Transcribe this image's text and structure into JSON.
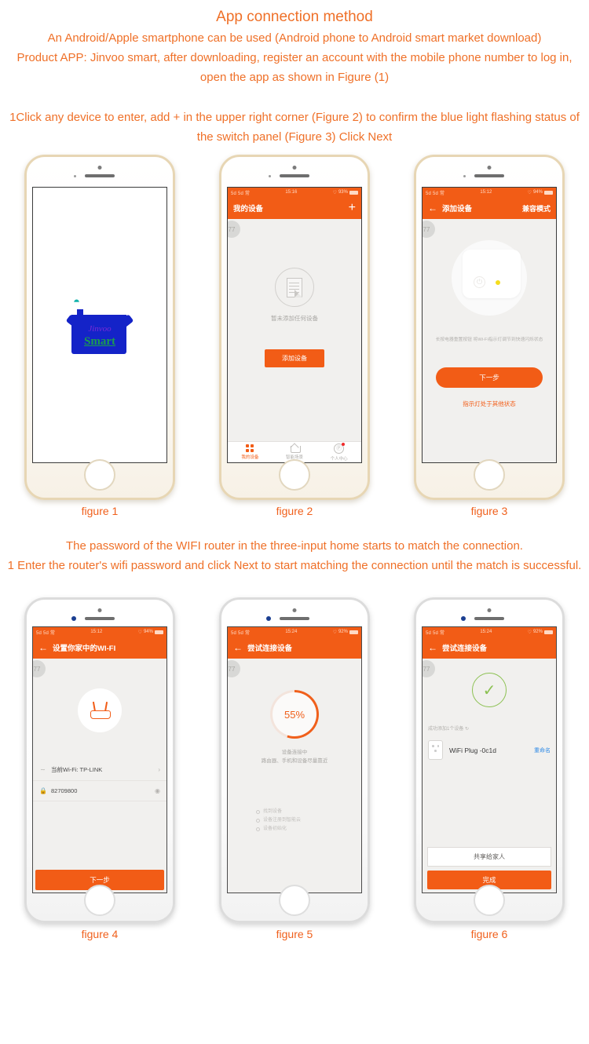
{
  "intro": {
    "title": "App connection method",
    "line1": "An Android/Apple smartphone can be used (Android phone to Android smart market download)",
    "line2": "Product APP: Jinvoo smart, after downloading, register an account with the mobile phone number to log in,",
    "line3": "open the app as shown in Figure (1)",
    "line4": "1Click any device to enter, add + in the upper right corner (Figure 2) to confirm the blue light flashing status of the switch panel (Figure 3) Click Next"
  },
  "mid": {
    "line1": "The password of the WIFI router in the three-input home starts to match the connection.",
    "line2": "1 Enter the router's wifi password and click Next to start matching the connection until the match is successful."
  },
  "captions": {
    "f1": "figure 1",
    "f2": "figure 2",
    "f3": "figure 3",
    "f4": "figure 4",
    "f5": "figure 5",
    "f6": "figure 6"
  },
  "colors": {
    "brand_orange": "#f25c16",
    "text_orange": "#ef7028",
    "logo_blue": "#1423c8",
    "success_green": "#8cc152",
    "link_blue": "#2e8ae6",
    "led_yellow": "#f5dd1e"
  },
  "figure1": {
    "logo_script": "Jinvoo",
    "logo_word": "Smart"
  },
  "figure2": {
    "status": {
      "carrier": "5d 5d 常",
      "time": "15:16",
      "battery": "93%"
    },
    "nav_title": "我的设备",
    "add_icon": "+",
    "watermark": "77",
    "empty_text": "暂未添加任何设备",
    "add_button": "添加设备",
    "tabs": [
      {
        "label": "我的设备",
        "icon": "grid-icon"
      },
      {
        "label": "智能场景",
        "icon": "home-icon"
      },
      {
        "label": "个人中心",
        "icon": "user-icon"
      }
    ]
  },
  "figure3": {
    "status": {
      "carrier": "5d 5d 常",
      "time": "15:12",
      "battery": "94%"
    },
    "back_icon": "←",
    "nav_title": "添加设备",
    "nav_right": "兼容模式",
    "watermark": "77",
    "hint": "长按电器重置按钮 将Wi-Fi指示灯调节到快速闪烁状态",
    "next_button": "下一步",
    "alt_link": "指示灯处于其他状态"
  },
  "figure4": {
    "status": {
      "carrier": "5d 5d 常",
      "time": "15:12",
      "battery": "94%"
    },
    "back_icon": "←",
    "nav_title": "设置你家中的WI-FI",
    "watermark": "77",
    "wifi_row": {
      "icon": "wifi-icon",
      "label": "当前Wi-Fi: TP-LINK",
      "chevron": "›"
    },
    "password_row": {
      "icon": "lock-icon",
      "value": "82709800",
      "eye": "◉"
    },
    "next_button": "下一步"
  },
  "figure5": {
    "status": {
      "carrier": "5d 5d 常",
      "time": "15:24",
      "battery": "92%"
    },
    "back_icon": "←",
    "nav_title": "尝试连接设备",
    "watermark": "77",
    "progress": "55%",
    "progress_value": 55,
    "status_line1": "设备连接中",
    "status_line2": "路由器、手机和设备尽量靠近",
    "steps": [
      "找到设备",
      "设备注册到智能云",
      "设备初始化"
    ]
  },
  "figure6": {
    "status": {
      "carrier": "5d 5d 常",
      "time": "15:24",
      "battery": "92%"
    },
    "back_icon": "←",
    "nav_title": "尝试连接设备",
    "watermark": "77",
    "check_icon": "✓",
    "added_text": "成功添加1个设备 ↻",
    "device_name": "WiFi Plug -0c1d",
    "rename": "重命名",
    "share_button": "共享给家人",
    "done_button": "完成"
  }
}
